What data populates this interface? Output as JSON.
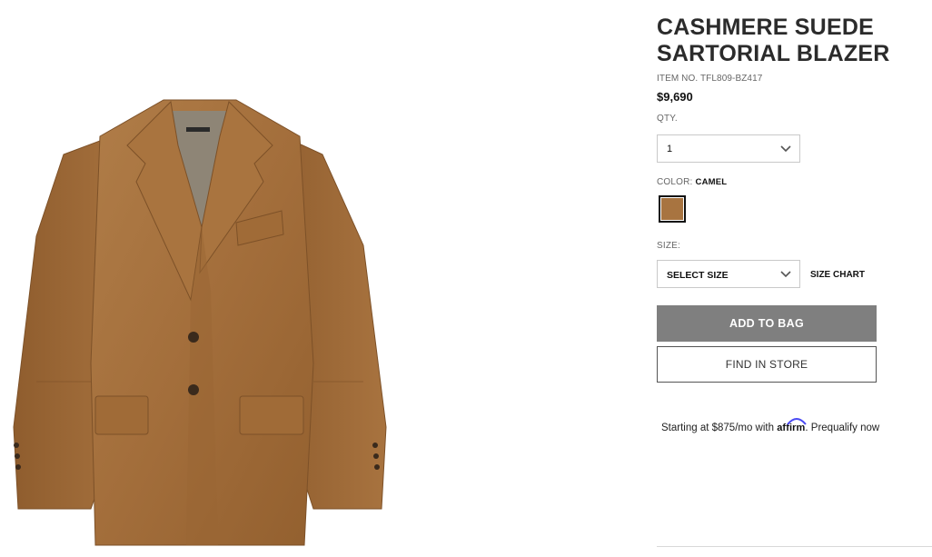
{
  "product": {
    "title": "CASHMERE SUEDE SARTORIAL BLAZER",
    "item_label": "ITEM NO.",
    "item_number": "TFL809-BZ417",
    "price": "$9,690"
  },
  "quantity": {
    "label": "QTY.",
    "selected": "1"
  },
  "color": {
    "label": "COLOR:",
    "selected": "CAMEL",
    "swatch_hex": "#a87440"
  },
  "size": {
    "label": "SIZE:",
    "selected": "SELECT SIZE",
    "chart_link": "SIZE CHART"
  },
  "actions": {
    "add_to_bag": "ADD TO BAG",
    "find_in_store": "FIND IN STORE"
  },
  "financing": {
    "prefix": "Starting at $875/mo with",
    "brand": "affirm",
    "suffix": ". Prequalify now"
  },
  "colors": {
    "add_to_bag_bg": "#7f7f7f",
    "suede": "#a87440",
    "suede_dark": "#8a5a2c",
    "lining": "#8e8576"
  }
}
